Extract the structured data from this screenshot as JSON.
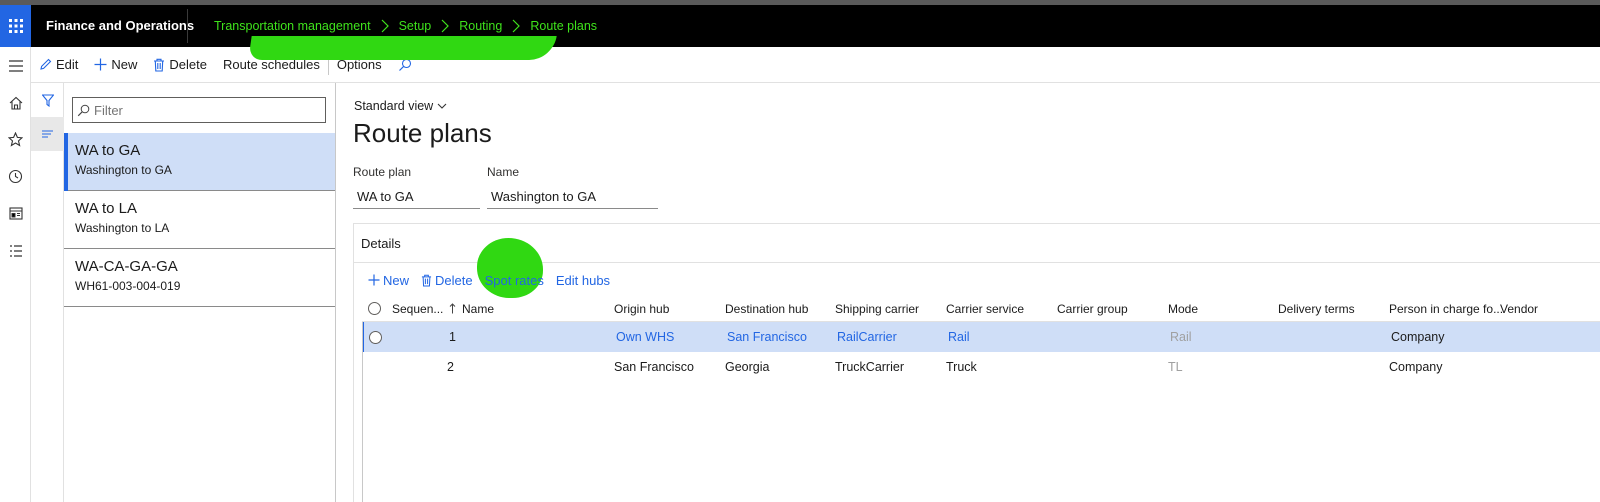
{
  "app": {
    "title": "Finance and Operations",
    "breadcrumb": [
      "Transportation management",
      "Setup",
      "Routing",
      "Route plans"
    ]
  },
  "colors": {
    "accent": "#2266e3",
    "breadcrumb": "#3fe31c",
    "annotation": "#30d812",
    "selected_row": "#cfdef7"
  },
  "actions": {
    "edit": "Edit",
    "new": "New",
    "delete": "Delete",
    "route_schedules": "Route schedules",
    "options": "Options"
  },
  "leftnav": {
    "icons": [
      "hamburger-icon",
      "home-icon",
      "star-icon",
      "clock-icon",
      "workspace-icon",
      "list-icon"
    ]
  },
  "filter": {
    "placeholder": "Filter"
  },
  "list": {
    "items": [
      {
        "title": "WA to GA",
        "subtitle": "Washington to GA",
        "selected": true
      },
      {
        "title": "WA to LA",
        "subtitle": "Washington to LA",
        "selected": false
      },
      {
        "title": "WA-CA-GA-GA",
        "subtitle": "WH61-003-004-019",
        "selected": false
      }
    ]
  },
  "main": {
    "view": "Standard view",
    "title": "Route plans",
    "route_plan_label": "Route plan",
    "route_plan_value": "WA to GA",
    "name_label": "Name",
    "name_value": "Washington to GA"
  },
  "details": {
    "title": "Details",
    "actions": {
      "new": "New",
      "delete": "Delete",
      "spot_rates": "Spot rates",
      "edit_hubs": "Edit hubs"
    },
    "columns": {
      "sequence": "Sequen...",
      "name": "Name",
      "origin_hub": "Origin hub",
      "destination_hub": "Destination hub",
      "shipping_carrier": "Shipping carrier",
      "carrier_service": "Carrier service",
      "carrier_group": "Carrier group",
      "mode": "Mode",
      "delivery_terms": "Delivery terms",
      "person_in_charge": "Person in charge fo...",
      "vendor": "Vendor"
    },
    "rows": [
      {
        "sequence": "1",
        "name": "",
        "origin_hub": "Own WHS",
        "destination_hub": "San Francisco",
        "shipping_carrier": "RailCarrier",
        "carrier_service": "Rail",
        "carrier_group": "",
        "mode": "Rail",
        "delivery_terms": "",
        "person_in_charge": "Company",
        "vendor": ""
      },
      {
        "sequence": "2",
        "name": "",
        "origin_hub": "San Francisco",
        "destination_hub": "Georgia",
        "shipping_carrier": "TruckCarrier",
        "carrier_service": "Truck",
        "carrier_group": "",
        "mode": "TL",
        "delivery_terms": "",
        "person_in_charge": "Company",
        "vendor": ""
      }
    ]
  }
}
